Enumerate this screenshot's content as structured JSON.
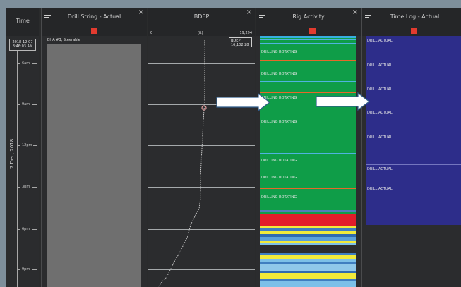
{
  "time_panel": {
    "title": "Time",
    "date_box_line1": "2018-12-07",
    "date_box_line2": "8:46:03 AM",
    "date_vertical": "7 Dec, 2018",
    "ticks": [
      "6am",
      "9am",
      "12pm",
      "3pm",
      "6pm",
      "9pm"
    ]
  },
  "drill_panel": {
    "title": "Drill String - Actual",
    "bha_label": "BHA #3, Steerable"
  },
  "bdep_panel": {
    "title": "BDEP",
    "scale_min": "0",
    "scale_unit": "(ft)",
    "scale_max": "19,294",
    "readout_label": "BDEP",
    "readout_value": "16,102.28"
  },
  "rig_panel": {
    "title": "Rig Activity",
    "labels": [
      "DRILLING ROTATING",
      "DRILLING ROTATING",
      "DRILLING ROTATING",
      "DRILLING ROTATING",
      "DRILLING ROTATING",
      "DRILLING ROTATING",
      "DRILLING ROTATING"
    ]
  },
  "timelog_panel": {
    "title": "Time Log - Actual",
    "labels": [
      "DRILL ACTUAL",
      "DRILL ACTUAL",
      "DRILL ACTUAL",
      "DRILL ACTUAL",
      "DRILL ACTUAL",
      "DRILL ACTUAL",
      "DRILL ACTUAL"
    ]
  },
  "icons": {
    "menu": "hamburger-menu-icon",
    "close": "close-icon",
    "indicator": "red-status-square",
    "callout": "right-arrow-icon"
  },
  "colors": {
    "rig_green": "#0f9d48",
    "rig_red": "#e11d2a",
    "rig_yellow": "#f1ea3a",
    "rig_blue": "#3f7ec0",
    "timelog_blue": "#2d2d8a",
    "indicator_red": "#e23b2f"
  }
}
